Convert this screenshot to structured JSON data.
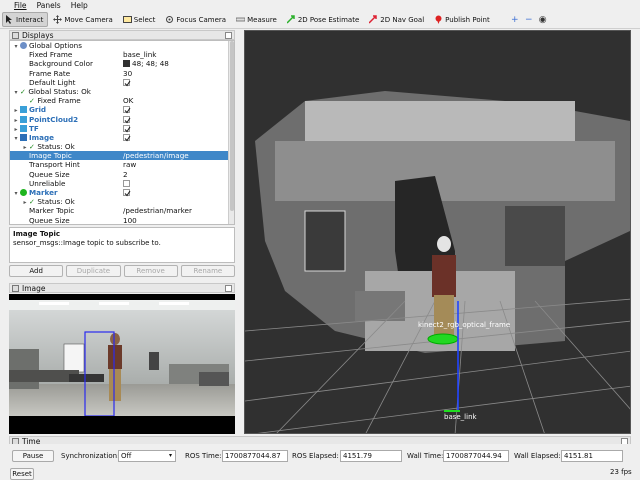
{
  "menu": {
    "file": "File",
    "panels": "Panels",
    "help": "Help"
  },
  "toolbar": {
    "tools": [
      {
        "label": "Interact",
        "icon": "cursor-icon"
      },
      {
        "label": "Move Camera",
        "icon": "move-camera-icon"
      },
      {
        "label": "Select",
        "icon": "select-icon"
      },
      {
        "label": "Focus Camera",
        "icon": "focus-camera-icon"
      },
      {
        "label": "Measure",
        "icon": "measure-icon"
      },
      {
        "label": "2D Pose Estimate",
        "icon": "pose-estimate-icon"
      },
      {
        "label": "2D Nav Goal",
        "icon": "nav-goal-icon"
      },
      {
        "label": "Publish Point",
        "icon": "publish-point-icon"
      }
    ],
    "extra": {
      "add": "+",
      "remove": "−",
      "eye": "◉"
    }
  },
  "displays": {
    "title": "Displays",
    "rows": [
      {
        "key": "Global Options",
        "value": "",
        "indent": 0,
        "arrow": "▾",
        "icon": "gear",
        "checkbox": null
      },
      {
        "key": "Fixed Frame",
        "value": "base_link",
        "indent": 1
      },
      {
        "key": "Background Color",
        "value": "48; 48; 48",
        "indent": 1,
        "swatch": "#303030"
      },
      {
        "key": "Frame Rate",
        "value": "30",
        "indent": 1
      },
      {
        "key": "Default Light",
        "value": "",
        "indent": 1,
        "checkbox": true
      },
      {
        "key": "Global Status: Ok",
        "value": "",
        "indent": 0,
        "arrow": "▾",
        "check": true
      },
      {
        "key": "Fixed Frame",
        "value": "OK",
        "indent": 1,
        "check": true
      },
      {
        "key": "Grid",
        "value": "",
        "indent": 0,
        "arrow": "▸",
        "icon": "grid",
        "blue": true,
        "checkbox": true
      },
      {
        "key": "PointCloud2",
        "value": "",
        "indent": 0,
        "arrow": "▸",
        "icon": "cloud",
        "blue": true,
        "checkbox": true
      },
      {
        "key": "TF",
        "value": "",
        "indent": 0,
        "arrow": "▸",
        "icon": "tf",
        "blue": true,
        "checkbox": true
      },
      {
        "key": "Image",
        "value": "",
        "indent": 0,
        "arrow": "▾",
        "icon": "image",
        "blue": true,
        "checkbox": true
      },
      {
        "key": "Status: Ok",
        "value": "",
        "indent": 1,
        "arrow": "▸",
        "check": true
      },
      {
        "key": "Image Topic",
        "value": "/pedestrian/image",
        "indent": 1,
        "selected": true
      },
      {
        "key": "Transport Hint",
        "value": "raw",
        "indent": 1
      },
      {
        "key": "Queue Size",
        "value": "2",
        "indent": 1
      },
      {
        "key": "Unreliable",
        "value": "",
        "indent": 1,
        "checkbox": false
      },
      {
        "key": "Marker",
        "value": "",
        "indent": 0,
        "arrow": "▾",
        "icon": "marker",
        "blue": true,
        "checkbox": true
      },
      {
        "key": "Status: Ok",
        "value": "",
        "indent": 1,
        "arrow": "▸",
        "check": true
      },
      {
        "key": "Marker Topic",
        "value": "/pedestrian/marker",
        "indent": 1
      },
      {
        "key": "Queue Size",
        "value": "100",
        "indent": 1
      }
    ],
    "help_title": "Image Topic",
    "help_text": "sensor_msgs::Image topic to subscribe to.",
    "buttons": {
      "add": "Add",
      "duplicate": "Duplicate",
      "remove": "Remove",
      "rename": "Rename"
    }
  },
  "image_panel": {
    "title": "Image"
  },
  "viewport": {
    "labels": {
      "kinect": "kinect2_rgb_optical_frame",
      "base": "base_link"
    }
  },
  "time": {
    "title": "Time",
    "pause": "Pause",
    "sync_label": "Synchronization:",
    "sync_value": "Off",
    "ros_time_label": "ROS Time:",
    "ros_time": "1700877044.87",
    "ros_elapsed_label": "ROS Elapsed:",
    "ros_elapsed": "4151.79",
    "wall_time_label": "Wall Time:",
    "wall_time": "1700877044.94",
    "wall_elapsed_label": "Wall Elapsed:",
    "wall_elapsed": "4151.81",
    "reset": "Reset",
    "fps": "23 fps"
  },
  "colors": {
    "selection": "#3f87c8",
    "accent_blue": "#2c6fb7",
    "ok_green": "#1f8a1f",
    "background": "#303030"
  }
}
